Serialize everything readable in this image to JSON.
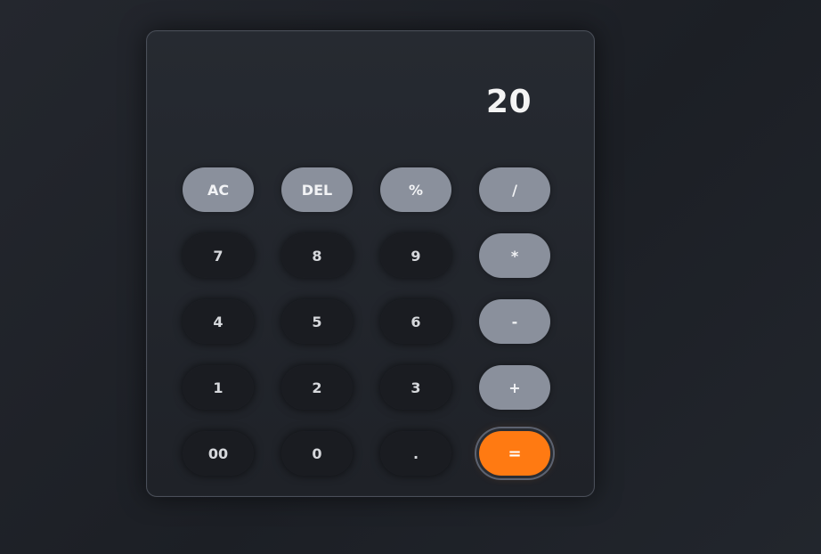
{
  "display": {
    "value": "20"
  },
  "keys": {
    "row1": [
      "AC",
      "DEL",
      "%",
      "/"
    ],
    "row2": [
      "7",
      "8",
      "9",
      "*"
    ],
    "row3": [
      "4",
      "5",
      "6",
      "-"
    ],
    "row4": [
      "1",
      "2",
      "3",
      "+"
    ],
    "row5": [
      "00",
      "0",
      ".",
      "="
    ]
  },
  "colors": {
    "equals_accent": "#ff7a12",
    "operator_key": "#8a909c",
    "number_key": "#1a1c21",
    "background": "#1f2228"
  }
}
